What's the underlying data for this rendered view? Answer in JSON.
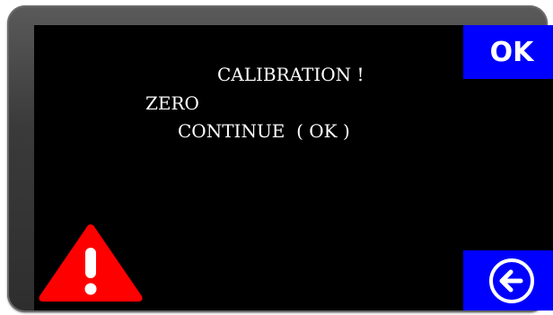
{
  "message": {
    "title": "CALIBRATION !",
    "line2": "ZERO",
    "line3": "CONTINUE  ( OK )"
  },
  "buttons": {
    "ok_label": "OK",
    "back_icon": "arrow-left-circle-icon"
  },
  "status": {
    "warning_icon": "warning-triangle-icon"
  },
  "colors": {
    "screen_background": "#000000",
    "button_blue": "#0000FF",
    "warning_red": "#FF0000",
    "text": "#FFFFFF"
  }
}
